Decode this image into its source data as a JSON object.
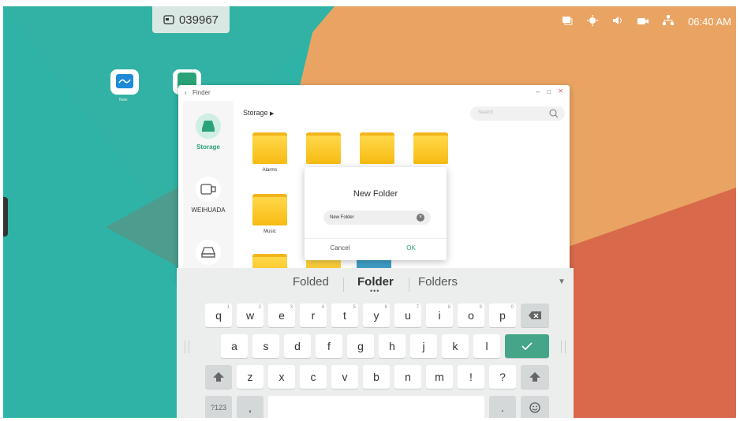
{
  "taskbar": {
    "code": "039967",
    "code_icon": "id-card-icon"
  },
  "status_bar": {
    "icons": [
      "screen-mirror-icon",
      "brightness-icon",
      "volume-icon",
      "camera-icon",
      "network-icon"
    ],
    "time": "06:40 AM"
  },
  "desktop": {
    "icons": [
      {
        "label": "Note",
        "icon": "note-app-icon"
      }
    ]
  },
  "finder": {
    "title": "Finder",
    "sidebar": [
      {
        "label": "Storage",
        "icon": "storage-icon",
        "active": true
      },
      {
        "label": "WEIHUADA",
        "icon": "usb-drive-icon",
        "active": false
      },
      {
        "label": "",
        "icon": "network-drive-icon",
        "active": false
      }
    ],
    "breadcrumb": "Storage",
    "search_placeholder": "Search",
    "folders": [
      {
        "label": "Alarms"
      },
      {
        "label": ""
      },
      {
        "label": ""
      },
      {
        "label": ""
      },
      {
        "label": "Music"
      },
      {
        "label": ""
      },
      {
        "label": ""
      },
      {
        "label": ""
      }
    ]
  },
  "dialog": {
    "title": "New Folder",
    "input_value": "New Folder",
    "cancel_label": "Cancel",
    "ok_label": "OK"
  },
  "keyboard": {
    "suggestions": [
      "Folded",
      "Folder",
      "Folders"
    ],
    "row1": [
      "q",
      "w",
      "e",
      "r",
      "t",
      "y",
      "u",
      "i",
      "o",
      "p"
    ],
    "row1_hints": [
      "1",
      "2",
      "3",
      "4",
      "5",
      "6",
      "7",
      "8",
      "9",
      "0"
    ],
    "row2": [
      "a",
      "s",
      "d",
      "f",
      "g",
      "h",
      "j",
      "k",
      "l"
    ],
    "row3": [
      "z",
      "x",
      "c",
      "v",
      "b",
      "n",
      "m",
      "!",
      "?"
    ],
    "row4": {
      "symbols": "?123",
      "comma": ",",
      "period": "."
    },
    "colors": {
      "accent": "#45a588",
      "background": "#eceeee"
    }
  }
}
